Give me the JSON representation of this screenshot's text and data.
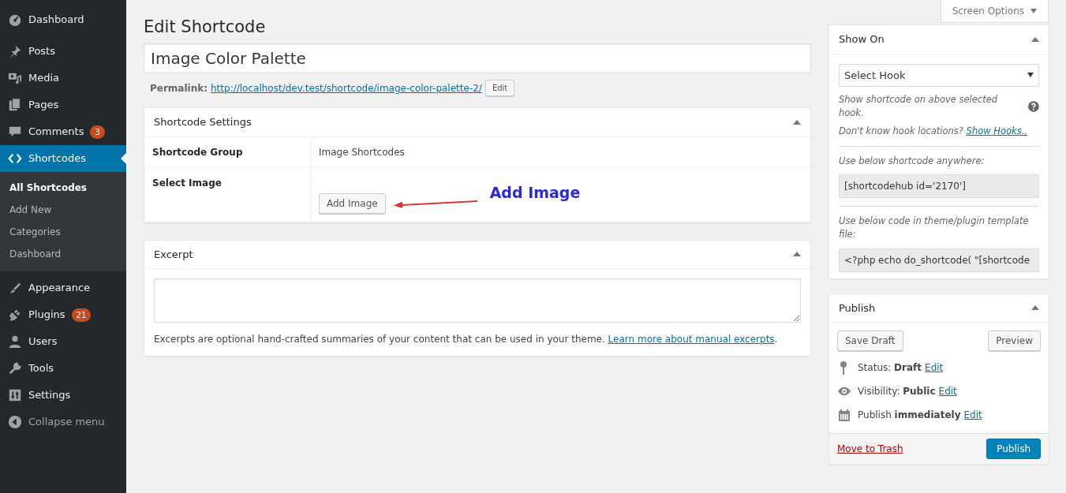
{
  "sidebar": {
    "items": [
      {
        "label": "Dashboard",
        "selected": false
      },
      {
        "label": "Posts",
        "selected": false
      },
      {
        "label": "Media",
        "selected": false
      },
      {
        "label": "Pages",
        "selected": false
      },
      {
        "label": "Comments",
        "badge": "3",
        "selected": false
      },
      {
        "label": "Shortcodes",
        "selected": true,
        "children": [
          {
            "label": "All Shortcodes",
            "selected": true
          },
          {
            "label": "Add New",
            "selected": false
          },
          {
            "label": "Categories",
            "selected": false
          },
          {
            "label": "Dashboard",
            "selected": false
          }
        ]
      },
      {
        "label": "Appearance",
        "selected": false
      },
      {
        "label": "Plugins",
        "badge": "21",
        "selected": false
      },
      {
        "label": "Users",
        "selected": false
      },
      {
        "label": "Tools",
        "selected": false
      },
      {
        "label": "Settings",
        "selected": false
      }
    ],
    "collapse": "Collapse menu"
  },
  "screen_options": "Screen Options",
  "heading": "Edit Shortcode",
  "title_field": {
    "value": "Image Color Palette"
  },
  "permalink": {
    "label": "Permalink:",
    "url": "http://localhost/dev.test/shortcode/image-color-palette-2/",
    "button": "Edit"
  },
  "settings_box": {
    "title": "Shortcode Settings",
    "rows": [
      {
        "kind": "text",
        "label": "Shortcode Group",
        "value": "Image Shortcodes"
      },
      {
        "kind": "button",
        "label": "Select Image",
        "value": "Add Image"
      }
    ],
    "annotation": "Add Image"
  },
  "excerpt_box": {
    "title": "Excerpt",
    "help": "Excerpts are optional hand-crafted summaries of your content that can be used in your theme.",
    "link": "Learn more about manual excerpts",
    "after": "."
  },
  "show_on_box": {
    "title": "Show On",
    "select": "Select Hook",
    "help": "Show shortcode on above selected hook.",
    "question": "Don't know hook locations?",
    "link": "Show Hooks..",
    "label_1": "Use below shortcode anywhere:",
    "code_1": "[shortcodehub id='2170']",
    "label_2": "Use below code in theme/plugin template file:",
    "code_2": "<?php echo do_shortcode( \"[shortcode"
  },
  "publish_box": {
    "title": "Publish",
    "save": "Save Draft",
    "preview": "Preview",
    "rows": [
      {
        "text": "Status: **Draft**",
        "link": "Edit"
      },
      {
        "text": "Visibility: **Public**",
        "link": "Edit"
      },
      {
        "text": "Publish **immediately**",
        "link": "Edit"
      }
    ],
    "trash": "Move to Trash",
    "publish": "Publish"
  }
}
